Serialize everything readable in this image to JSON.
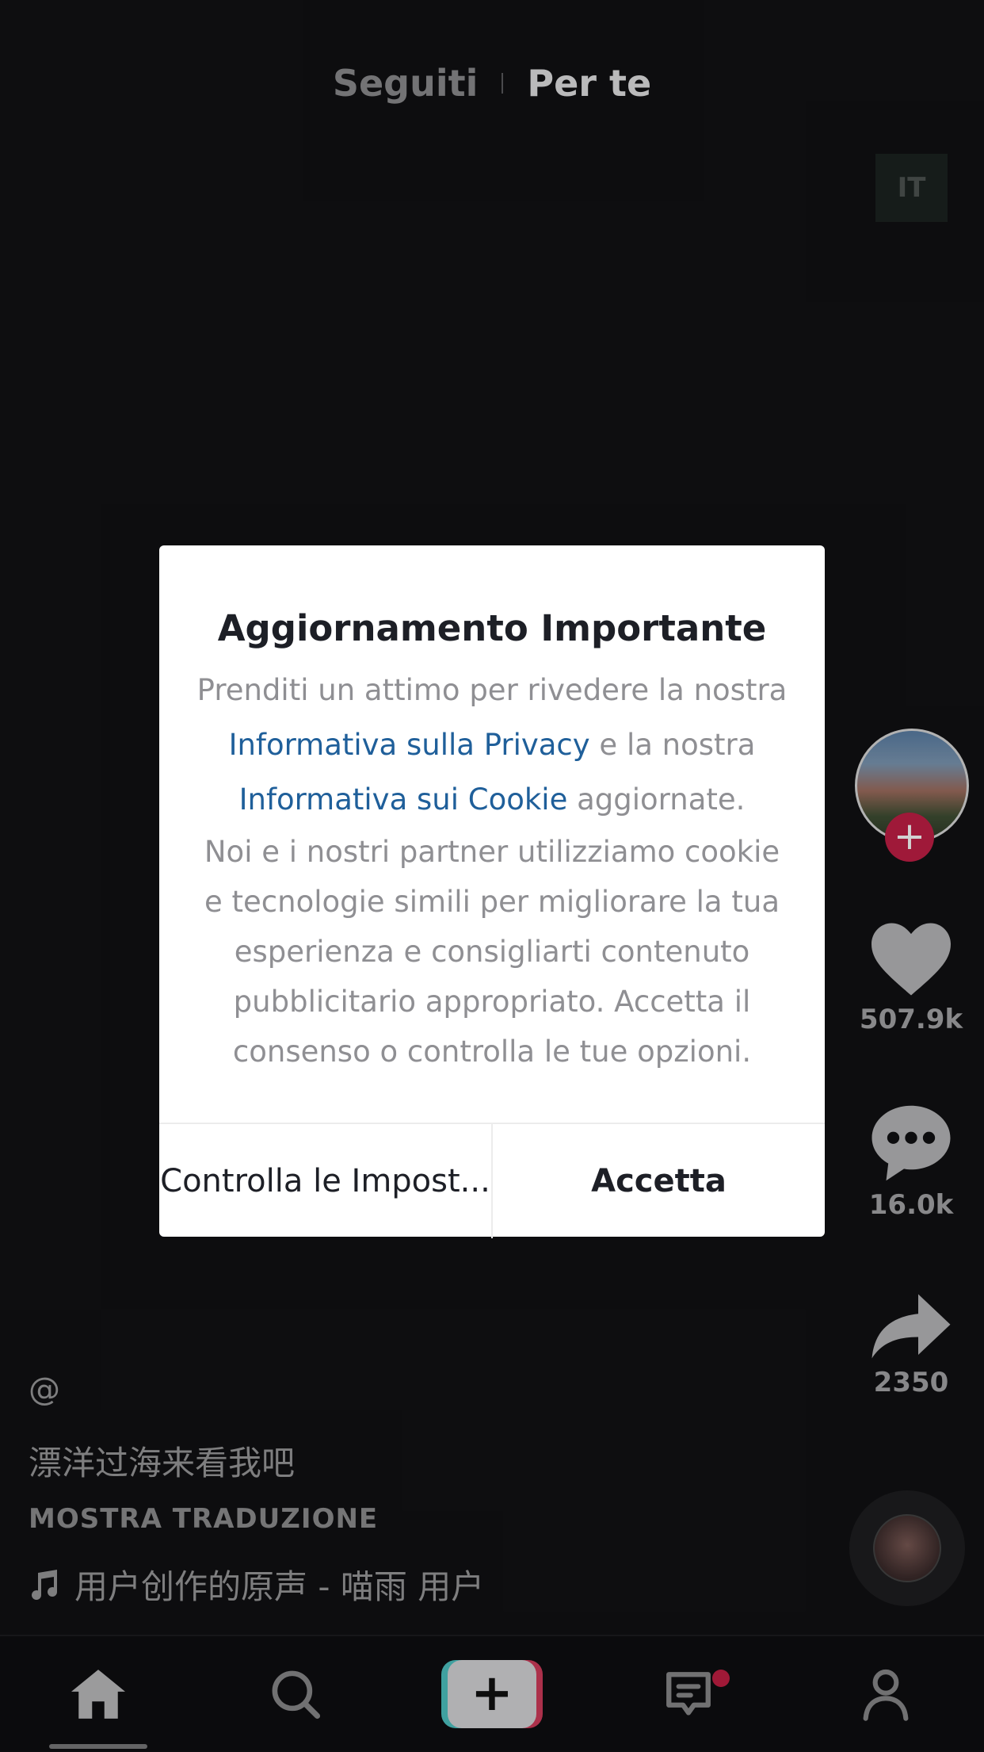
{
  "top_tabs": {
    "following": "Seguiti",
    "for_you": "Per te",
    "language_badge": "IT"
  },
  "rail": {
    "likes": "507.9k",
    "comments": "16.0k",
    "shares": "2350"
  },
  "caption": {
    "username": "@",
    "description": "漂洋过海来看我吧",
    "translate": "MOSTRA TRADUZIONE",
    "music": "用户创作的原声 - 喵雨    用户"
  },
  "modal": {
    "title": "Aggiornamento Importante",
    "line1": "Prenditi un attimo per rivedere la nostra",
    "privacy_link": "Informativa sulla Privacy",
    "line2_tail": " e la nostra",
    "cookie_link": "Informativa sui Cookie",
    "line3_tail": " aggiornate.",
    "para2_l1": "Noi e i nostri partner utilizziamo cookie",
    "para2_l2": "e tecnologie simili per migliorare la tua",
    "para2_l3": "esperienza e consigliarti contenuto",
    "para2_l4": "pubblicitario appropriato. Accetta il",
    "para2_l5": "consenso o controlla le tue opzioni.",
    "settings_button": "Controlla le Impost...",
    "accept_button": "Accetta"
  },
  "nav": {
    "create_symbol": "+",
    "follow_symbol": "+"
  },
  "colors": {
    "background": "#111113",
    "accent_red": "#c31f46",
    "link_blue": "#1f5f9a",
    "create_cyan": "#4fc5c4",
    "create_pink": "#d23c5c"
  },
  "icons": [
    "heart-icon",
    "comment-icon",
    "share-icon",
    "music-note-icon",
    "home-icon",
    "search-icon",
    "inbox-icon",
    "profile-icon"
  ]
}
